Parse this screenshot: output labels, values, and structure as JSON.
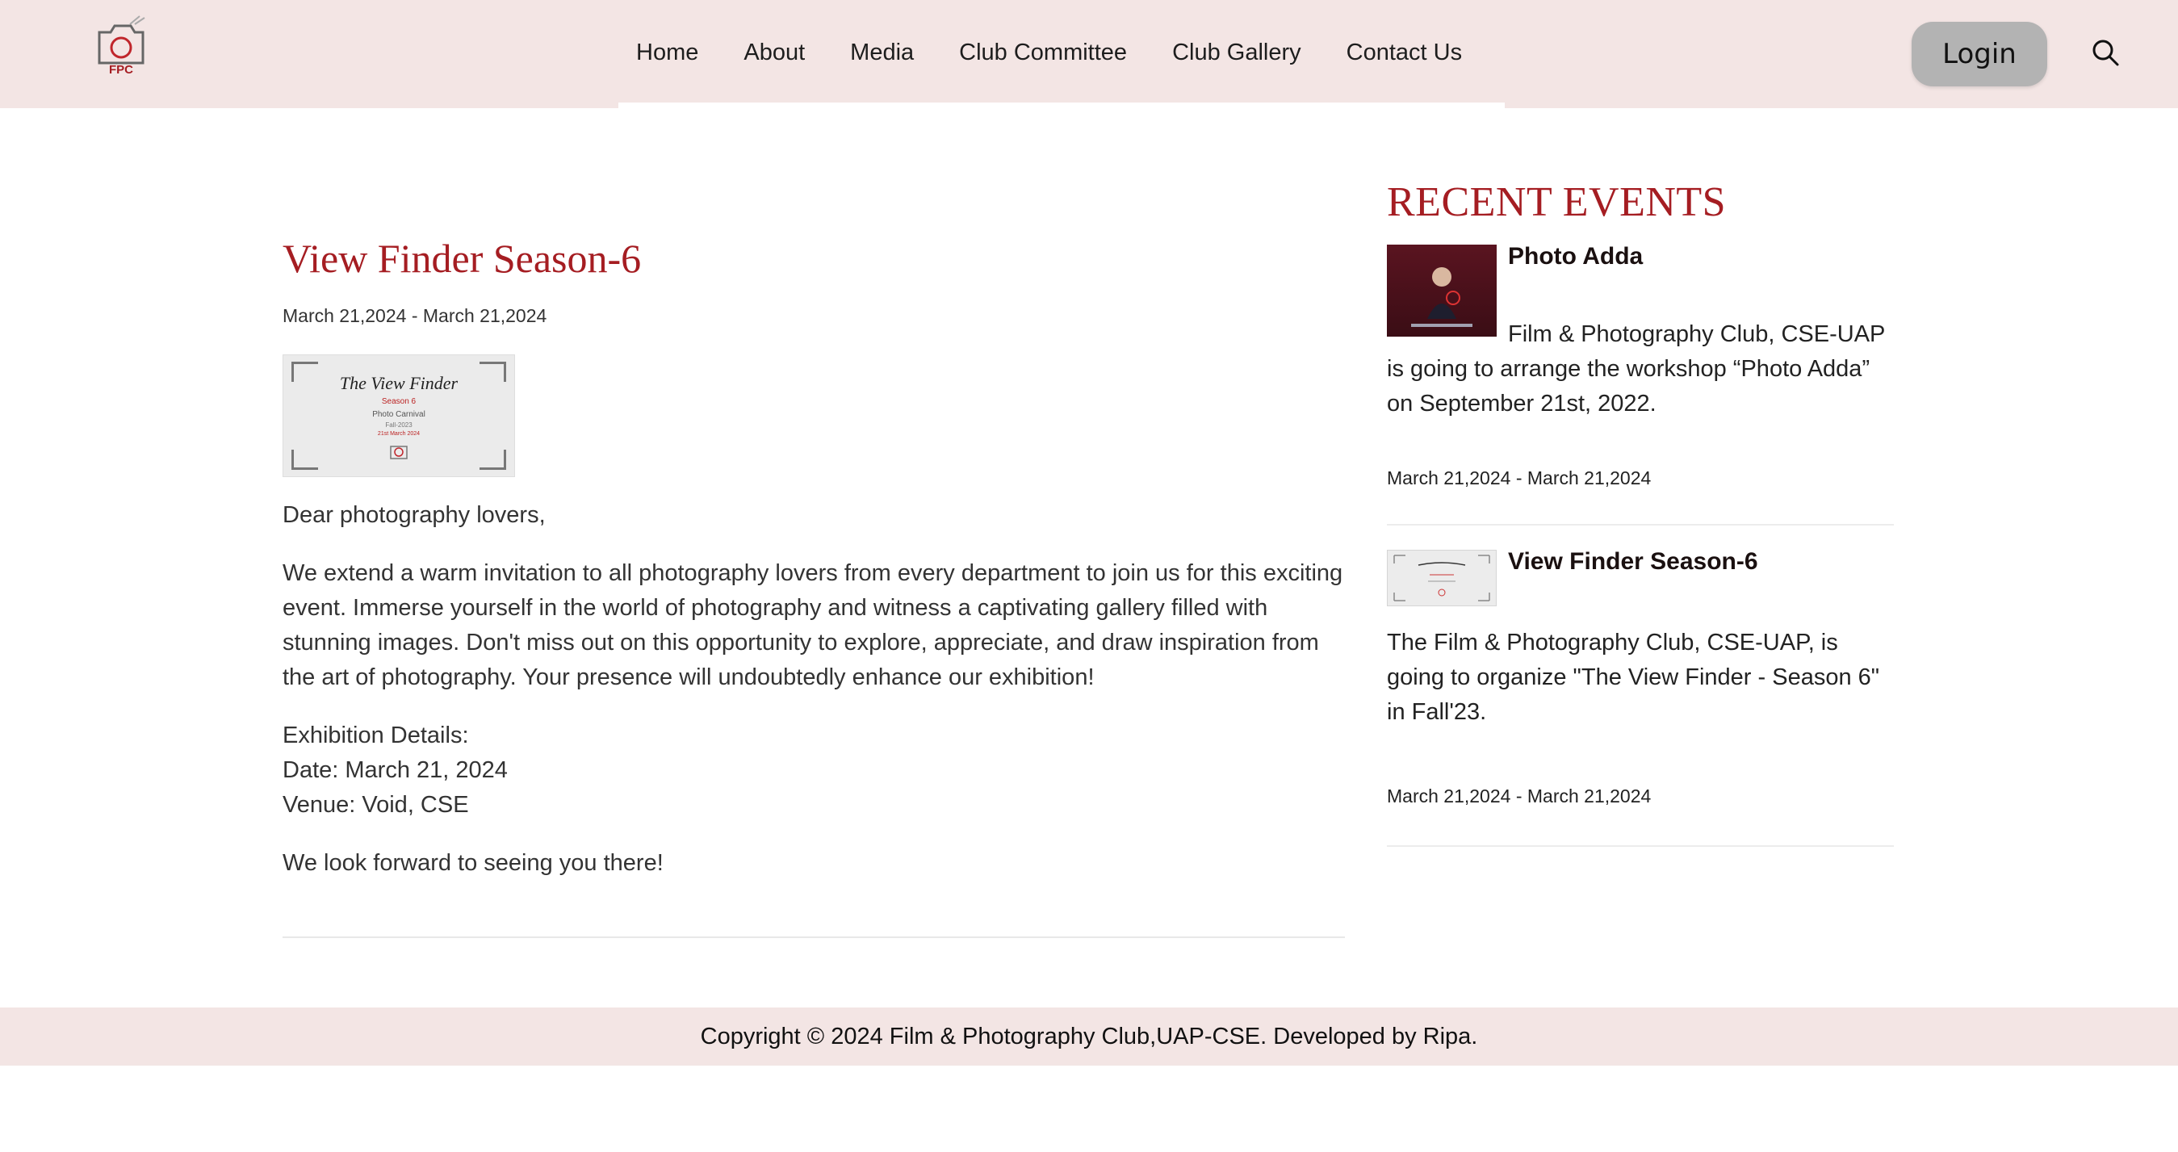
{
  "nav": {
    "logo_text": "FPC",
    "items": [
      {
        "label": "Home"
      },
      {
        "label": "About"
      },
      {
        "label": "Media"
      },
      {
        "label": "Club Committee"
      },
      {
        "label": "Club Gallery"
      },
      {
        "label": "Contact Us"
      }
    ],
    "login_label": "Login",
    "search_icon": "search-icon"
  },
  "event": {
    "title": "View Finder Season-6",
    "date": "March 21,2024 - March 21,2024",
    "poster": {
      "title": "The View Finder",
      "season": "Season 6",
      "subtitle": "Photo Carnival",
      "term": "Fall-2023",
      "date": "21st March 2024"
    },
    "greeting": "Dear photography lovers,",
    "invitation": "We extend a warm invitation to all photography lovers from every department to join us for this exciting event. Immerse yourself in the world of photography and witness a captivating gallery filled with stunning images. Don't miss out on this opportunity to explore, appreciate, and draw inspiration from the art of photography. Your presence will undoubtedly enhance our exhibition!",
    "details_heading": "Exhibition Details:",
    "details_date": "Date: March 21, 2024",
    "details_venue": "Venue: Void, CSE",
    "closing": "We look forward to seeing you there!"
  },
  "sidebar": {
    "heading": "RECENT EVENTS",
    "items": [
      {
        "title": "Photo Adda",
        "description": "Film & Photography Club, CSE-UAP is going to arrange the workshop “Photo Adda” on September 21st, 2022.",
        "date": "March 21,2024 - March 21,2024"
      },
      {
        "title": "View Finder Season-6",
        "description": "The Film & Photography Club, CSE-UAP, is going to organize \"The View Finder - Season 6\" in Fall'23.",
        "date": "March 21,2024 - March 21,2024"
      }
    ]
  },
  "footer": {
    "copyright": "Copyright © 2024 Film & Photography Club,UAP-CSE. Developed by Ripa."
  },
  "colors": {
    "accent": "#a51d22",
    "header_bg": "#f3e5e4",
    "login_bg": "#b3b3b3"
  }
}
